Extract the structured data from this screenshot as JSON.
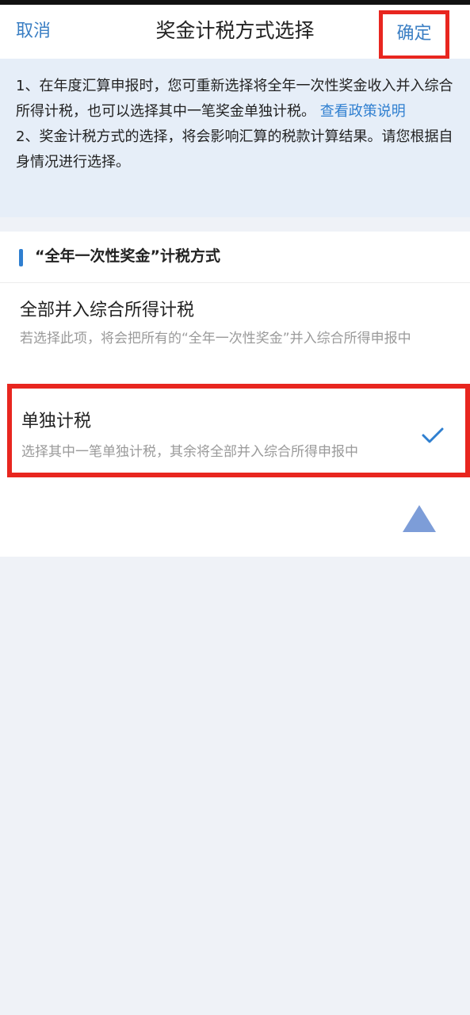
{
  "navbar": {
    "cancel_label": "取消",
    "title": "奖金计税方式选择",
    "confirm_label": "确定"
  },
  "notice": {
    "line1_text": "1、在年度汇算申报时，您可重新选择将全年一次性奖金收入并入综合所得计税，也可以选择其中一笔奖金单独计税。",
    "policy_link": "查看政策说明",
    "line2_text": "2、奖金计税方式的选择，将会影响汇算的税款计算结果。请您根据自身情况进行选择。"
  },
  "section": {
    "title": "“全年一次性奖金”计税方式"
  },
  "options": [
    {
      "title": "全部并入综合所得计税",
      "description": "若选择此项，将会把所有的“全年一次性奖金”并入综合所得申报中",
      "selected": false
    },
    {
      "title": "单独计税",
      "description": "选择其中一笔单独计税，其余将全部并入综合所得申报中",
      "selected": true
    }
  ],
  "icons": {
    "check": "check-icon",
    "scroll_top": "triangle-up-icon"
  },
  "colors": {
    "accent": "#2f7fd0",
    "highlight_border": "#e8261f",
    "notice_bg": "#e6eef8"
  }
}
